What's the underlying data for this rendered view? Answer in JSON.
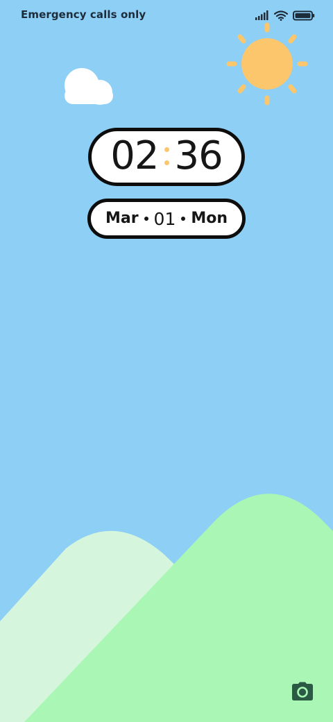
{
  "status_bar": {
    "carrier_text": "Emergency calls only",
    "icons": [
      "signal-icon",
      "wifi-icon",
      "battery-icon"
    ]
  },
  "clock": {
    "hours": "02",
    "minutes": "36"
  },
  "date": {
    "month": "Mar",
    "day": "01",
    "weekday": "Mon"
  },
  "wallpaper": {
    "elements": [
      "sun-icon",
      "cloud-icon",
      "hills"
    ]
  },
  "shortcuts": {
    "camera": "camera-icon"
  },
  "colors": {
    "sky": "#8ecff5",
    "sun": "#fbc66c",
    "hill_front": "#aaf7b5",
    "hill_back": "#d6f5dd",
    "pill_border": "#0d0d0d",
    "camera_icon": "#2b5a44"
  }
}
